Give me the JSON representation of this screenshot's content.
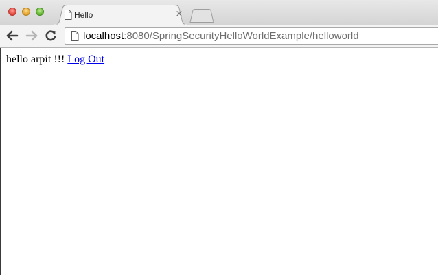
{
  "browser": {
    "tab": {
      "title": "Hello",
      "close_glyph": "×",
      "icon": "document-icon"
    },
    "toolbar": {
      "back_icon": "arrow-left-icon",
      "forward_icon": "arrow-right-icon",
      "reload_icon": "reload-icon"
    },
    "address_bar": {
      "host": "localhost",
      "path": ":8080/SpringSecurityHelloWorldExample/helloworld",
      "icon": "document-icon"
    },
    "colors": {
      "close_red": "#e0443a",
      "minimize_yellow": "#e0a228",
      "zoom_green": "#5fb22f",
      "link_blue": "#0000ee"
    }
  },
  "page": {
    "greeting": "hello arpit !!!",
    "logout_link": "Log Out"
  }
}
